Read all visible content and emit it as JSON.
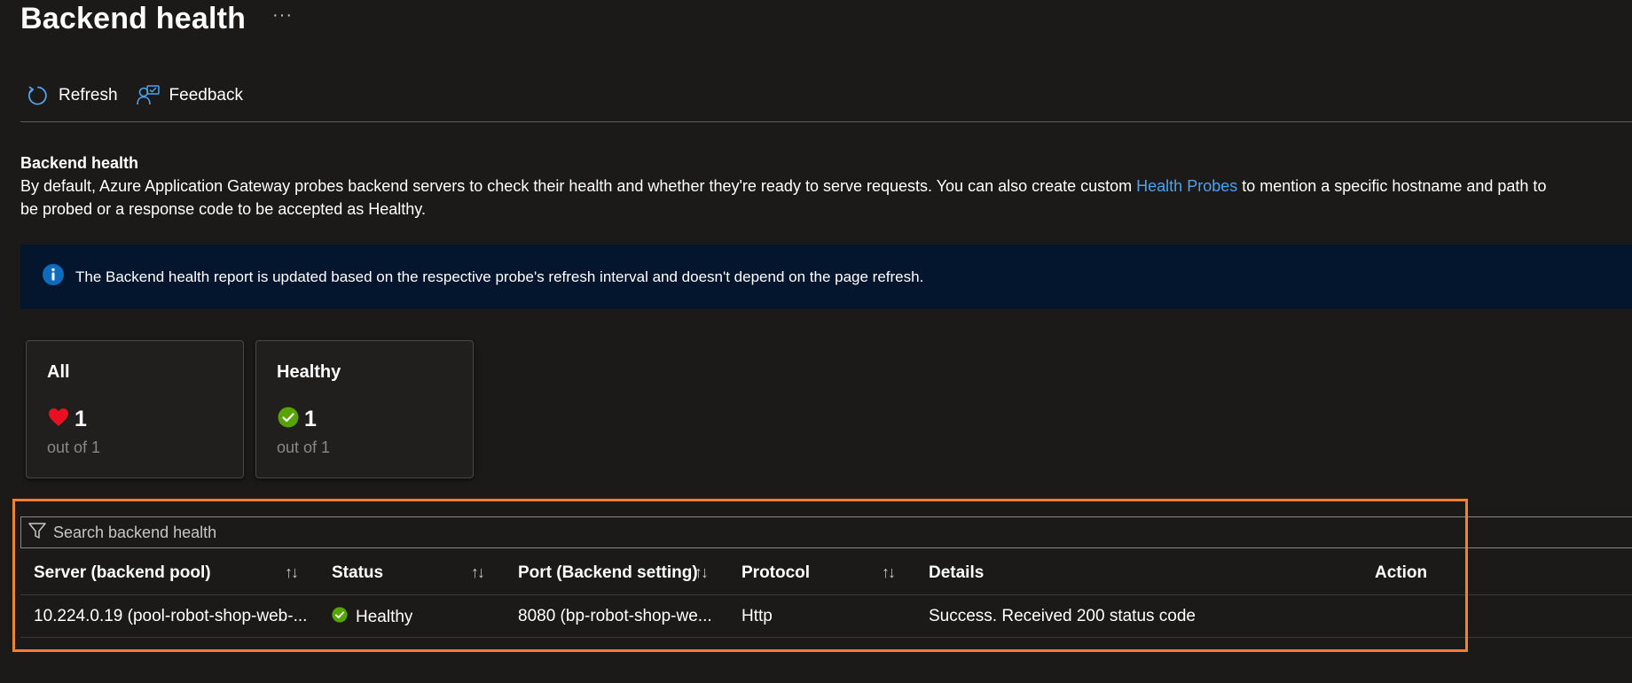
{
  "page": {
    "title": "Backend health",
    "more_label": "···"
  },
  "toolbar": {
    "refresh_label": "Refresh",
    "feedback_label": "Feedback"
  },
  "description": {
    "title": "Backend health",
    "text_before_link": "By default, Azure Application Gateway probes backend servers to check their health and whether they're ready to serve requests. You can also create custom ",
    "link_text": "Health Probes",
    "text_after_link": " to mention a specific hostname and path to",
    "line2": "be probed or a response code to be accepted as Healthy."
  },
  "info_banner": {
    "icon": "info-icon",
    "text": "The Backend health report is updated based on the respective probe's refresh interval and doesn't depend on the page refresh."
  },
  "summary_cards": [
    {
      "title": "All",
      "icon": "heart-icon",
      "count": "1",
      "subtext": "out of 1"
    },
    {
      "title": "Healthy",
      "icon": "check-circle-icon",
      "count": "1",
      "subtext": "out of 1"
    }
  ],
  "search": {
    "placeholder": "Search backend health",
    "value": ""
  },
  "table": {
    "sort_glyph": "↑↓",
    "columns": [
      "Server (backend pool)",
      "Status",
      "Port (Backend setting)",
      "Protocol",
      "Details",
      "Action"
    ],
    "rows": [
      {
        "server": "10.224.0.19 (pool-robot-shop-web-...",
        "status": "Healthy",
        "port": "8080 (bp-robot-shop-we...",
        "protocol": "Http",
        "details": "Success. Received 200 status code",
        "action": ""
      }
    ]
  },
  "colors": {
    "background": "#1b1a19",
    "link": "#4ea1f0",
    "info_banner": "#04152e",
    "highlight": "#f5822a",
    "healthy": "#57a300",
    "heart": "#e81123"
  }
}
